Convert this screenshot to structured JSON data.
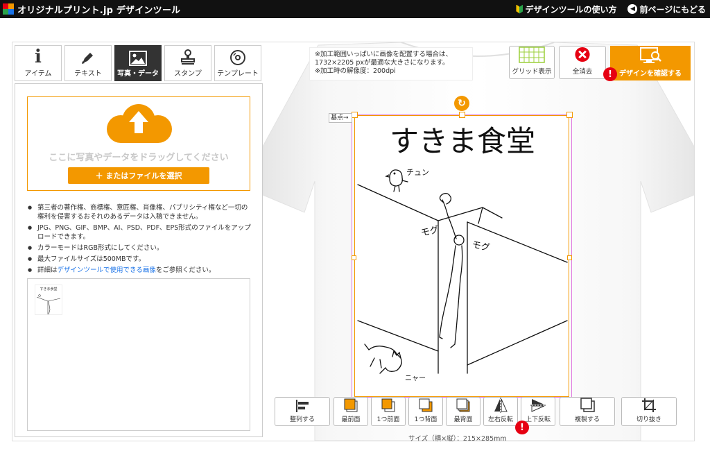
{
  "header": {
    "logo_text": "オリジナルプリント.jp デザインツール",
    "guide_link": "デザインツールの使い方",
    "back_link": "前ページにもどる"
  },
  "tabs": [
    {
      "label": "アイテム",
      "icon": "info-icon"
    },
    {
      "label": "テキスト",
      "icon": "pen-icon"
    },
    {
      "label": "写真・データ",
      "icon": "image-icon",
      "active": true
    },
    {
      "label": "スタンプ",
      "icon": "stamp-icon"
    },
    {
      "label": "テンプレート",
      "icon": "disc-icon"
    }
  ],
  "upload": {
    "drop_text": "ここに写真やデータをドラッグしてください",
    "select_button": "＋ またはファイルを選択"
  },
  "notes": {
    "n1": "第三者の著作権、商標権、意匠権、肖像権、パブリシティ権など一切の権利を侵害するおそれのあるデータは入稿できません。",
    "n2": "JPG、PNG、GIF、BMP、AI、PSD、PDF、EPS形式のファイルをアップロードできます。",
    "n3": "カラーモードはRGB形式にしてください。",
    "n4": "最大ファイルサイズは500MBです。",
    "n5_pre": "詳細は",
    "n5_link": "デザインツールで使用できる画像",
    "n5_post": "をご参照ください。"
  },
  "info": {
    "line1": "※加工範囲いっぱいに画像を配置する場合は、",
    "line2": "1732×2205 pxが最適な大きさになります。",
    "line3": "※加工時の解像度：200dpi"
  },
  "top_tools": {
    "grid": "グリッド表示",
    "clear": "全消去",
    "confirm": "デザインを確認する"
  },
  "design": {
    "title": "すきま食堂",
    "chun": "チュン",
    "mogu": "モグ",
    "nyaa": "ニャー",
    "origin": "基点→",
    "thumb_title": "すきま食堂"
  },
  "bottom_tools": {
    "align": "整列する",
    "front": "最前面",
    "forward": "1つ前面",
    "backward": "1つ背面",
    "back": "最背面",
    "flip_h": "左右反転",
    "flip_v": "上下反転",
    "duplicate": "複製する",
    "crop": "切り抜き"
  },
  "size_text": "サイズ（横×縦）：215×285mm",
  "colors": {
    "accent": "#f39800",
    "alert": "#e60012",
    "dark": "#111111",
    "link": "#1a73e8"
  }
}
